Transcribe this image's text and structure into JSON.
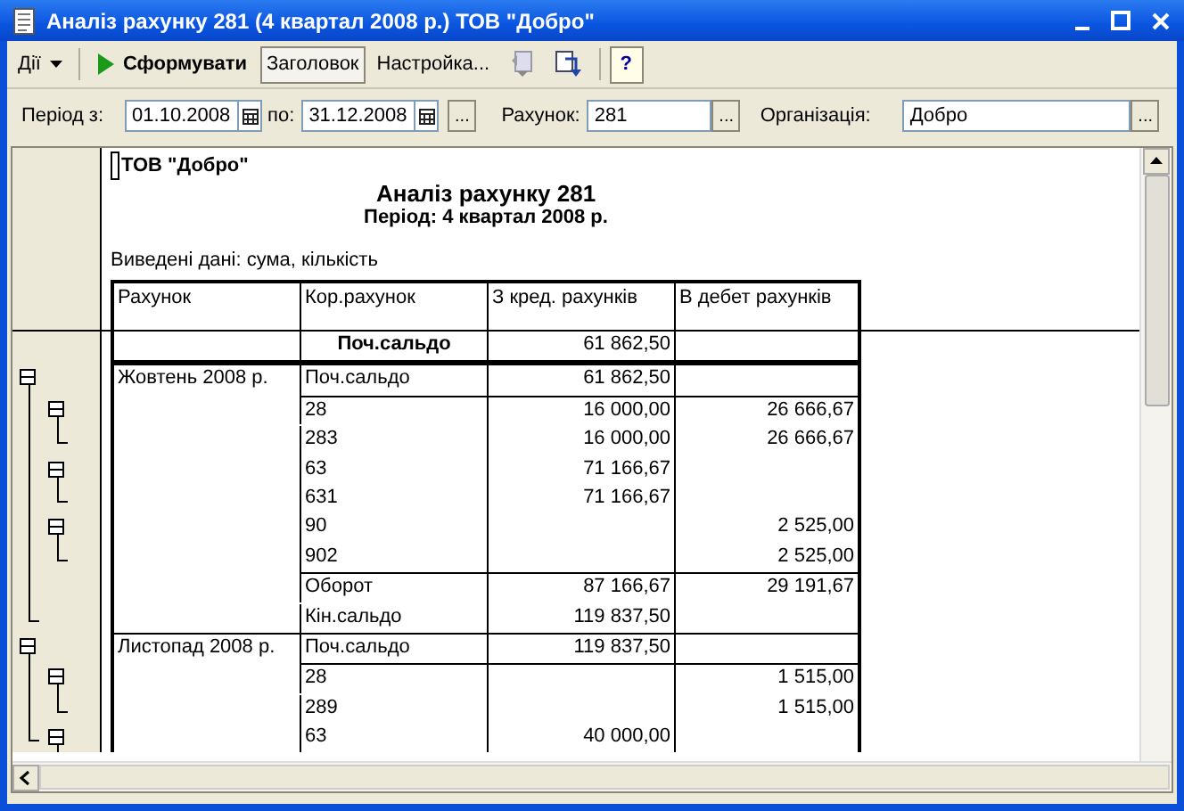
{
  "window": {
    "title": "Аналіз рахунку 281 (4 квартал 2008 р.) ТОВ \"Добро\""
  },
  "toolbar": {
    "actions": "Дії",
    "generate": "Сформувати",
    "header": {
      "label": "Заголовок",
      "selected": true
    },
    "settings": "Настройка...",
    "help": "?"
  },
  "filters": {
    "period_from_label": "Період з:",
    "period_from": "01.10.2008",
    "period_to_label": "по:",
    "period_to": "31.12.2008",
    "period_button": "...",
    "account_label": "Рахунок:",
    "account": "281",
    "account_button": "...",
    "organization_label": "Організація:",
    "organization": "Добро",
    "organization_button": "..."
  },
  "report": {
    "company": "ТОВ \"Добро\"",
    "title": "Аналіз рахунку 281",
    "period": "Період: 4 квартал 2008 р.",
    "shown_data": "Виведені дані: сума, кількість",
    "columns": [
      "Рахунок",
      "Кор.рахунок",
      "З кред. рахунків",
      "В дебет рахунків"
    ],
    "opening": {
      "label": "Поч.сальдо",
      "credit": "61 862,50"
    },
    "months": [
      {
        "label": "Жовтень 2008 р.",
        "expanded": true,
        "opening": {
          "account": "Поч.сальдо",
          "credit": "61 862,50"
        },
        "children": [
          {
            "expanded": true,
            "children": [
              {
                "account": "28",
                "credit": "16 000,00",
                "debit": "26 666,67"
              },
              {
                "account": "283",
                "credit": "16 000,00",
                "debit": "26 666,67"
              }
            ]
          },
          {
            "expanded": true,
            "children": [
              {
                "account": "63",
                "credit": "71 166,67"
              },
              {
                "account": "631",
                "credit": "71 166,67"
              }
            ]
          },
          {
            "expanded": true,
            "children": [
              {
                "account": "90",
                "debit": "2 525,00"
              },
              {
                "account": "902",
                "debit": "2 525,00"
              }
            ]
          }
        ],
        "totals": [
          {
            "account": "Оборот",
            "credit": "87 166,67",
            "debit": "29 191,67"
          },
          {
            "account": "Кін.сальдо",
            "credit": "119 837,50"
          }
        ]
      },
      {
        "label": "Листопад 2008 р.",
        "expanded": true,
        "opening": {
          "account": "Поч.сальдо",
          "credit": "119 837,50"
        },
        "children": [
          {
            "expanded": true,
            "children": [
              {
                "account": "28",
                "debit": "1 515,00"
              },
              {
                "account": "289",
                "debit": "1 515,00"
              }
            ]
          },
          {
            "expanded": true,
            "children": [
              {
                "account": "63",
                "credit": "40 000,00"
              }
            ]
          }
        ]
      }
    ]
  }
}
